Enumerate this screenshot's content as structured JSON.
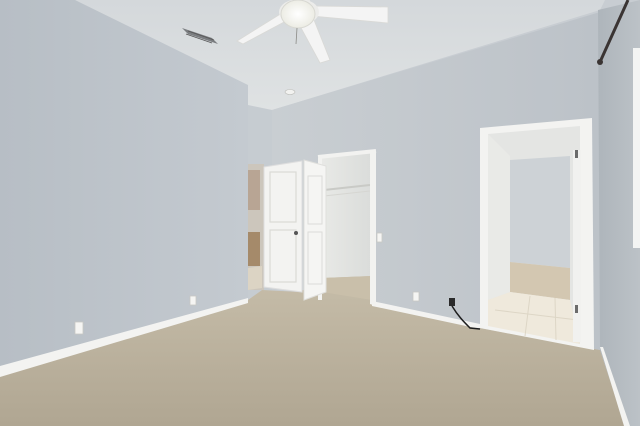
{
  "scene": {
    "kind": "empty bedroom interior",
    "colors": {
      "wall_left": "#bcc3c9",
      "wall_back": "#c3c9ce",
      "wall_right": "#b3b9bf",
      "ceiling": "#d9dcde",
      "carpet": "#bcb29f",
      "trim": "#f2f2f0",
      "door": "#f4f4f2",
      "closet_interior": "#e8e9e6",
      "hall_tile": "#efe9dc",
      "fan_blade": "#f4f4f4",
      "fan_light": "#fbfbf6"
    },
    "objects": [
      "ceiling-fan",
      "air-vent",
      "smoke-detector",
      "closet-door",
      "walk-in-closet",
      "bathroom-doorway",
      "hallway-doorway",
      "curtain-rod",
      "window-edge",
      "electrical-outlets",
      "light-switch",
      "power-cord"
    ]
  }
}
